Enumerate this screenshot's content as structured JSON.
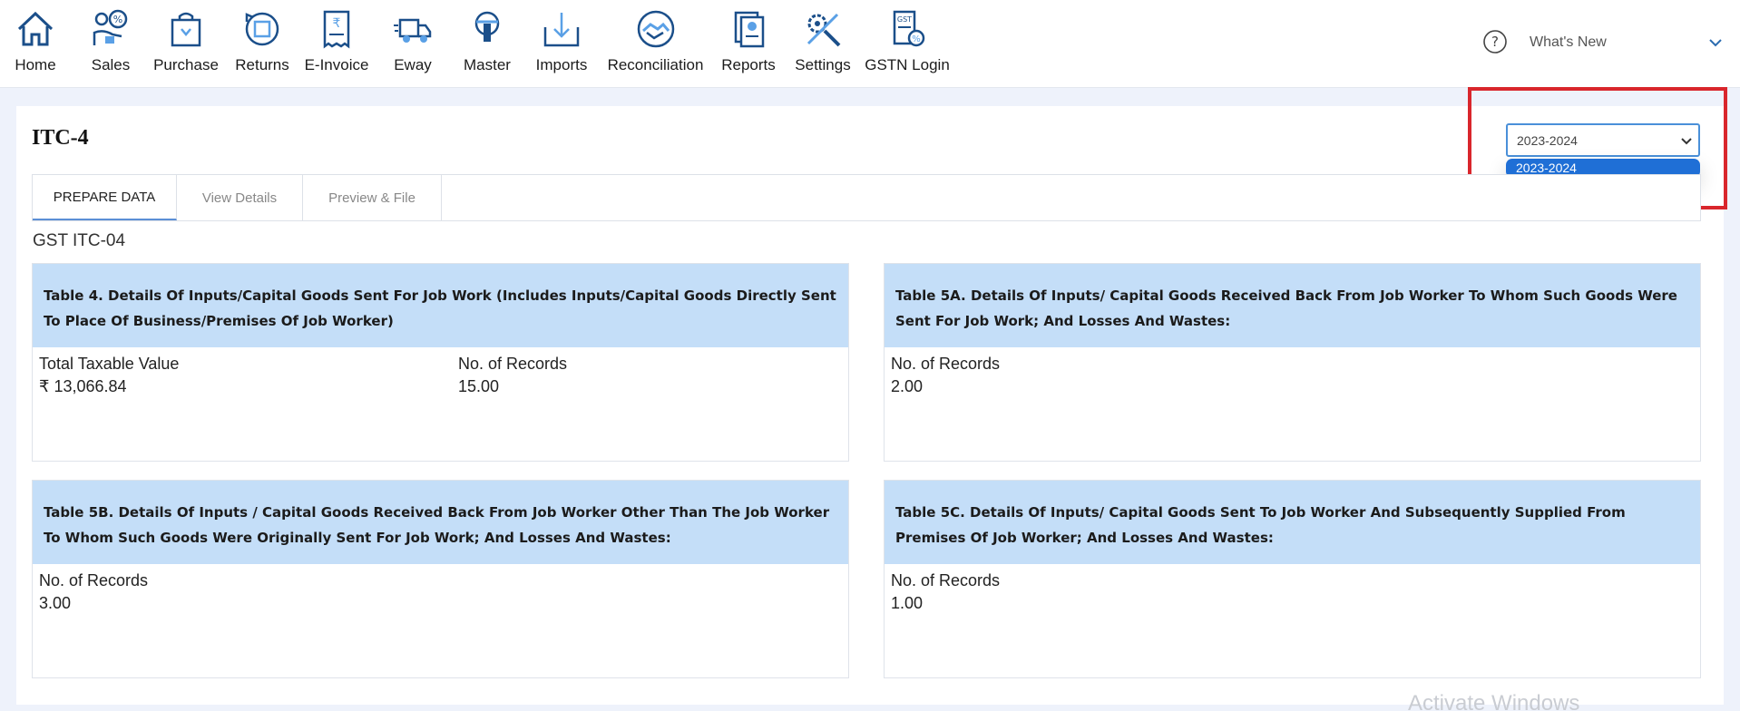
{
  "nav": {
    "items": [
      {
        "label": "Home",
        "icon": "home-icon"
      },
      {
        "label": "Sales",
        "icon": "sales-icon"
      },
      {
        "label": "Purchase",
        "icon": "purchase-icon"
      },
      {
        "label": "Returns",
        "icon": "returns-icon"
      },
      {
        "label": "E-Invoice",
        "icon": "einvoice-icon"
      },
      {
        "label": "Eway",
        "icon": "eway-truck-icon"
      },
      {
        "label": "Master",
        "icon": "master-icon"
      },
      {
        "label": "Imports",
        "icon": "imports-icon"
      },
      {
        "label": "Reconciliation",
        "icon": "reconciliation-icon"
      },
      {
        "label": "Reports",
        "icon": "reports-icon"
      },
      {
        "label": "Settings",
        "icon": "settings-icon"
      },
      {
        "label": "GSTN Login",
        "icon": "gstn-login-icon"
      }
    ],
    "whats_new": "What's New"
  },
  "page": {
    "title": "ITC-4",
    "year_selected": "2023-2024",
    "year_options": [
      "2023-2024"
    ],
    "section_title": "GST ITC-04"
  },
  "tabs": [
    {
      "label": "PREPARE DATA",
      "active": true
    },
    {
      "label": "View Details",
      "active": false
    },
    {
      "label": "Preview & File",
      "active": false
    }
  ],
  "panels": {
    "t4": {
      "title": "Table 4. Details Of Inputs/Capital Goods Sent For Job Work (Includes Inputs/Capital Goods Directly Sent To Place Of Business/Premises Of Job Worker)",
      "taxable_label": "Total Taxable Value",
      "taxable_value": "₹ 13,066.84",
      "records_label": "No. of Records",
      "records_value": "15.00"
    },
    "t5a": {
      "title": "Table 5A. Details Of Inputs/ Capital Goods Received Back From Job Worker To Whom Such Goods Were Sent For Job Work; And Losses And Wastes:",
      "records_label": "No. of Records",
      "records_value": "2.00"
    },
    "t5b": {
      "title": "Table 5B. Details Of Inputs / Capital Goods Received Back From Job Worker Other Than The Job Worker To Whom Such Goods Were Originally Sent For Job Work; And Losses And Wastes:",
      "records_label": "No. of Records",
      "records_value": "3.00"
    },
    "t5c": {
      "title": "Table 5C. Details Of Inputs/ Capital Goods Sent To Job Worker And Subsequently Supplied From Premises Of Job Worker; And Losses And Wastes:",
      "records_label": "No. of Records",
      "records_value": "1.00"
    }
  },
  "watermark": "Activate Windows",
  "colors": {
    "accent": "#1f6fd6",
    "panel_header": "#c4def8",
    "highlight": "#d9262c",
    "icon_blue": "#1b4f8a"
  }
}
